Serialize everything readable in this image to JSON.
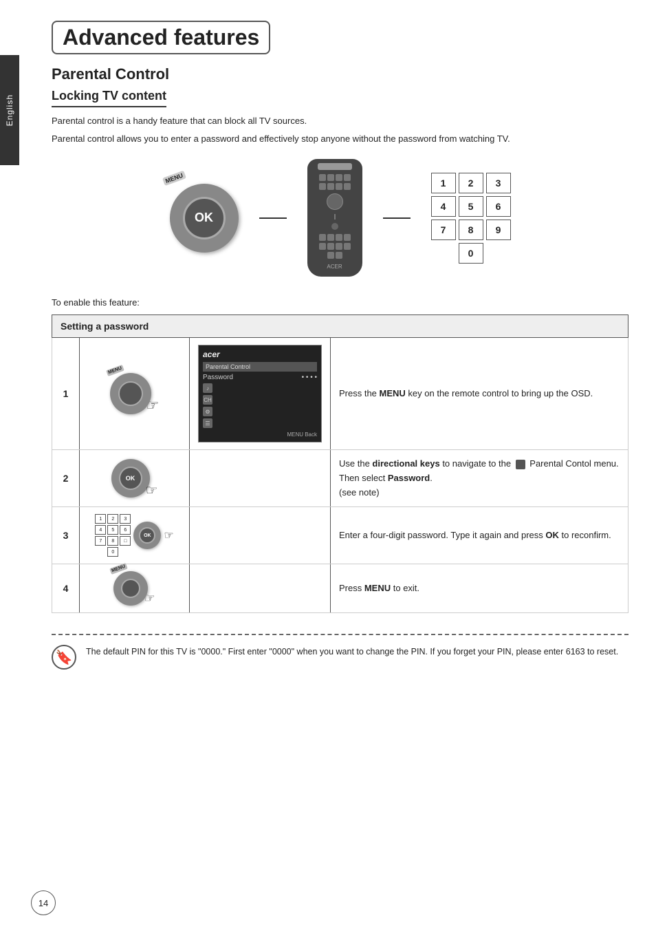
{
  "page": {
    "number": "14",
    "side_tab": "English"
  },
  "title": "Advanced features",
  "section": {
    "heading": "Parental Control",
    "subsection": "Locking TV content",
    "para1": "Parental control is a handy feature that can block all TV sources.",
    "para2": "Parental control allows you to enter a password and effectively stop anyone without the password from watching TV.",
    "enable_text": "To enable this feature:",
    "table_header": "Setting a password"
  },
  "numpad": {
    "keys": [
      [
        "1",
        "2",
        "3"
      ],
      [
        "4",
        "5",
        "6"
      ],
      [
        "7",
        "8",
        "9"
      ],
      [
        "0"
      ]
    ]
  },
  "steps": [
    {
      "num": "1",
      "desc_html": "Press the <b>MENU</b> key on the remote control to bring up the OSD."
    },
    {
      "num": "2",
      "desc_html": "Use the <b>directional keys</b> to navigate to the Parental Contol menu. Then select <b>Password</b>.\n(see note)"
    },
    {
      "num": "3",
      "desc_html": "Enter a four-digit password. Type it again and press <b>OK</b> to reconfirm."
    },
    {
      "num": "4",
      "desc_html": "Press <b>MENU</b> to exit."
    }
  ],
  "osd": {
    "brand": "acer",
    "menu_title": "Parental Control",
    "field_label": "Password",
    "field_value": "• • • •",
    "footer": "MENU Back"
  },
  "note": {
    "text": "The default PIN for this TV is \"0000.\" First enter \"0000\" when you want to change the PIN. If you forget your PIN, please enter 6163 to reset."
  }
}
